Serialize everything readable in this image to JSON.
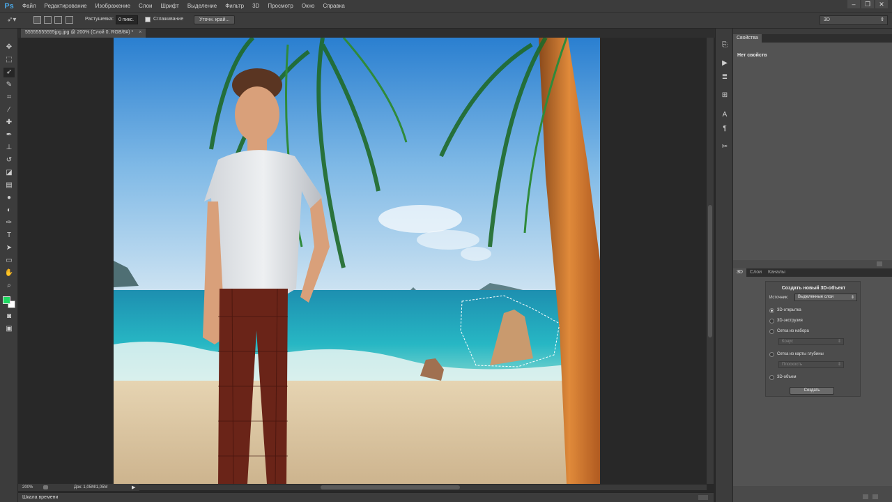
{
  "app": {
    "logo": "Ps"
  },
  "menu": [
    "Файл",
    "Редактирование",
    "Изображение",
    "Слои",
    "Шрифт",
    "Выделение",
    "Фильтр",
    "3D",
    "Просмотр",
    "Окно",
    "Справка"
  ],
  "window_controls": {
    "minimize": "–",
    "maximize": "❐",
    "close": "✕"
  },
  "options": {
    "feather_label": "Растушевка:",
    "feather_value": "0 пикс.",
    "antialias_label": "Сглаживание",
    "refine_button": "Уточн. край...",
    "workspace": "3D"
  },
  "document": {
    "tab_title": "55555555555jpg.jpg @ 200% (Слой 0, RGB/8#) *",
    "tab_close": "×"
  },
  "status": {
    "zoom": "200%",
    "doc_size": "Док: 1,05M/1,05M",
    "arrow": "▶"
  },
  "timeline": {
    "label": "Шкала времени"
  },
  "colors": {
    "foreground": "#1ed760",
    "background": "#ffffff",
    "accent": "#4aa3df"
  },
  "properties_panel": {
    "tab": "Свойства",
    "empty_text": "Нет свойств"
  },
  "three_d_panel": {
    "tabs": [
      "3D",
      "Слои",
      "Каналы"
    ],
    "title": "Создать новый 3D-объект",
    "source_label": "Источник:",
    "source_value": "Выделенные слои",
    "options": [
      {
        "label": "3D-открытка",
        "selected": true
      },
      {
        "label": "3D-экструзия",
        "selected": false
      },
      {
        "label": "Сетка из набора",
        "selected": false
      },
      {
        "label": "Сетка из карты глубины",
        "selected": false
      },
      {
        "label": "3D-объем",
        "selected": false
      }
    ],
    "preset_value": "Конус",
    "depth_value": "Плоскость",
    "create_button": "Создать"
  }
}
